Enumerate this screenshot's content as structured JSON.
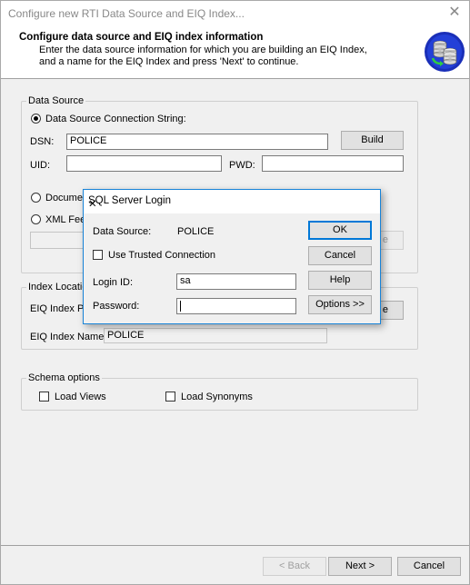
{
  "window": {
    "title": "Configure new RTI Data Source and EIQ Index...",
    "close_glyph": "✕"
  },
  "header": {
    "title": "Configure data source and EIQ index information",
    "description": "Enter the data source information for which you are building an EIQ Index, and a name for the EIQ Index and press 'Next' to continue.",
    "logo_icon": "database-stack-icon"
  },
  "data_source": {
    "legend": "Data Source",
    "conn_string_label": "Data Source Connection String:",
    "dsn_label": "DSN:",
    "dsn_value": "POLICE",
    "build_label": "Build",
    "uid_label": "UID:",
    "uid_value": "",
    "pwd_label": "PWD:",
    "pwd_value": "",
    "document_label": "Documen",
    "xml_feed_label": "XML Fee",
    "browse_partial": "e"
  },
  "index_location": {
    "legend": "Index Locatio",
    "path_label": "EIQ Index Pa",
    "browse_partial": "e",
    "name_label": "EIQ Index Name:",
    "name_value": "POLICE"
  },
  "schema": {
    "legend": "Schema options",
    "load_views": "Load Views",
    "load_synonyms": "Load Synonyms"
  },
  "footer": {
    "back": "< Back",
    "next": "Next >",
    "cancel": "Cancel"
  },
  "login": {
    "title": "SQL Server Login",
    "close_glyph": "✕",
    "data_source_label": "Data Source:",
    "data_source_value": "POLICE",
    "trusted_label": "Use Trusted Connection",
    "login_id_label": "Login ID:",
    "login_id_value": "sa",
    "password_label": "Password:",
    "password_value": "",
    "ok": "OK",
    "cancel": "Cancel",
    "help": "Help",
    "options": "Options >>"
  }
}
